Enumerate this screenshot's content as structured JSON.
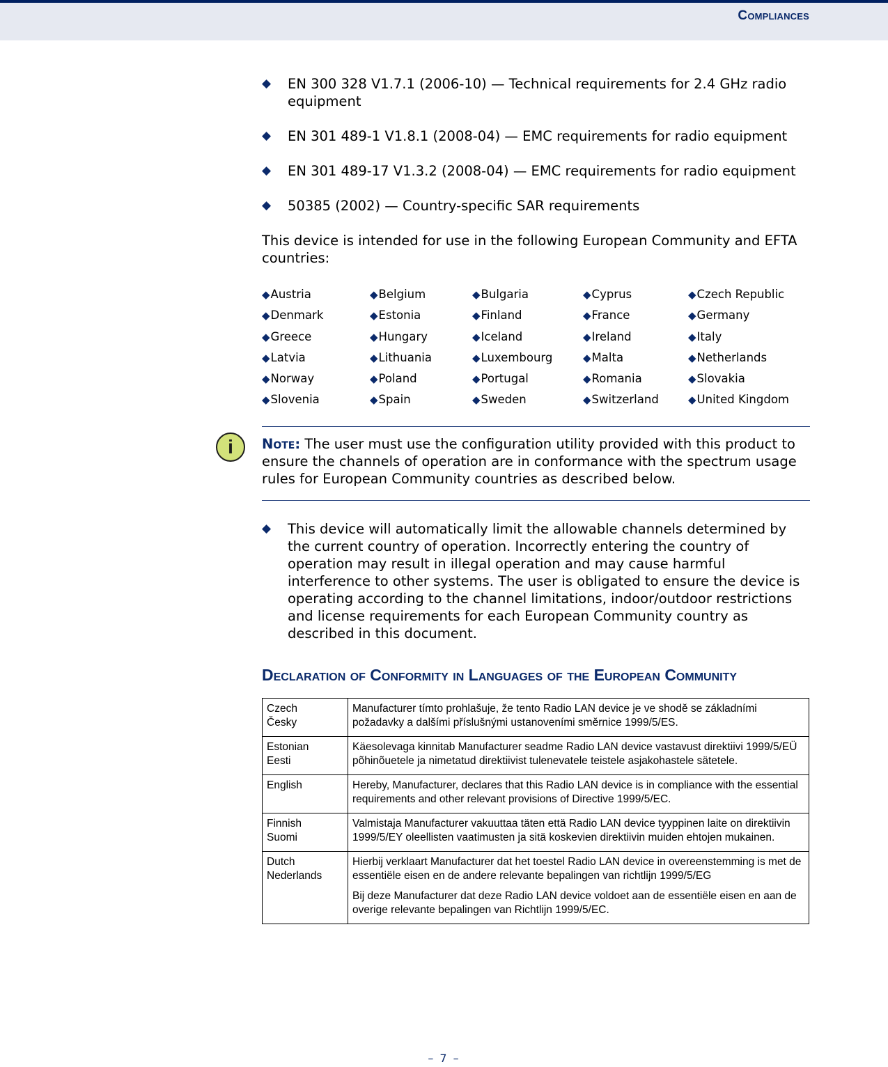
{
  "header": {
    "title": "Compliances"
  },
  "standards": [
    "EN 300 328 V1.7.1 (2006-10) — Technical requirements for 2.4 GHz radio equipment",
    "EN 301 489-1 V1.8.1 (2008-04) — EMC requirements for radio equipment",
    "EN 301 489-17 V1.3.2 (2008-04) — EMC requirements for radio equipment",
    "50385 (2002) — Country-specific SAR requirements"
  ],
  "intro": "This device is intended for use in the following European Community and EFTA countries:",
  "bullet_glyph": "◆",
  "countries": [
    "Austria",
    "Belgium",
    "Bulgaria",
    "Cyprus",
    "Czech Republic",
    "Denmark",
    "Estonia",
    "Finland",
    "France",
    "Germany",
    "Greece",
    "Hungary",
    "Iceland",
    "Ireland",
    "Italy",
    "Latvia",
    "Lithuania",
    "Luxembourg",
    "Malta",
    "Netherlands",
    "Norway",
    "Poland",
    "Portugal",
    "Romania",
    "Slovakia",
    "Slovenia",
    "Spain",
    "Sweden",
    "Switzerland",
    "United Kingdom"
  ],
  "note": {
    "icon": "info-icon",
    "icon_glyph": "i",
    "label": "Note:",
    "text": " The user must use the configuration utility provided with this product to ensure the channels of operation are in conformance with the spectrum usage rules for European Community countries as described below."
  },
  "channel_bullet": "This device will automatically limit the allowable channels determined by the current country of operation. Incorrectly entering the country of operation may result in illegal operation and may cause harmful interference to other systems. The user is obligated to ensure the device is operating according to the channel limitations, indoor/outdoor restrictions and license requirements for each European Community country as described in this document.",
  "section_title": "Declaration of Conformity in Languages of the European Community",
  "declarations": [
    {
      "lang": "Czech",
      "native": "Česky",
      "text": [
        "Manufacturer tímto prohlašuje, že tento Radio LAN device je ve shodě se základními požadavky a dalšími příslušnými ustanoveními směrnice 1999/5/ES."
      ]
    },
    {
      "lang": "Estonian",
      "native": "Eesti",
      "text": [
        "Käesolevaga kinnitab Manufacturer seadme Radio LAN device vastavust direktiivi 1999/5/EÜ põhinõuetele ja nimetatud direktiivist tulenevatele teistele asjakohastele sätetele."
      ]
    },
    {
      "lang": "English",
      "native": "",
      "text": [
        "Hereby, Manufacturer, declares that this Radio LAN device is in compliance with the essential requirements and other relevant provisions of Directive 1999/5/EC."
      ]
    },
    {
      "lang": "Finnish",
      "native": "Suomi",
      "text": [
        "Valmistaja Manufacturer vakuuttaa täten että Radio LAN device tyyppinen laite on direktiivin 1999/5/EY oleellisten vaatimusten ja sitä koskevien direktiivin muiden ehtojen mukainen."
      ]
    },
    {
      "lang": "Dutch",
      "native": "Nederlands",
      "text": [
        "Hierbij verklaart Manufacturer dat het toestel Radio LAN device in overeenstemming is met de essentiële eisen en de andere relevante bepalingen van richtlijn 1999/5/EG",
        "Bij deze Manufacturer dat deze Radio LAN device voldoet aan de essentiële eisen en aan de overige relevante bepalingen van Richtlijn 1999/5/EC."
      ]
    }
  ],
  "footer": {
    "page": "– 7 –"
  }
}
